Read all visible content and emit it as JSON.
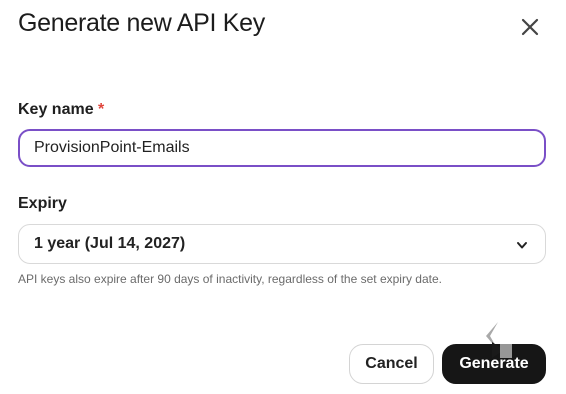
{
  "dialog": {
    "title": "Generate new API Key"
  },
  "key_name": {
    "label": "Key name",
    "required_marker": "*",
    "value": "ProvisionPoint-Emails"
  },
  "expiry": {
    "label": "Expiry",
    "selected": "1 year (Jul 14, 2027)",
    "help_text": "API keys also expire after 90 days of inactivity, regardless of the set expiry date."
  },
  "actions": {
    "cancel_label": "Cancel",
    "generate_label": "Generate"
  },
  "colors": {
    "focus_border": "#7a4fc7",
    "required": "#e0453c",
    "primary_button": "#161616"
  },
  "icons": {
    "close": "close-icon",
    "dropdown": "chevron-down-icon"
  }
}
